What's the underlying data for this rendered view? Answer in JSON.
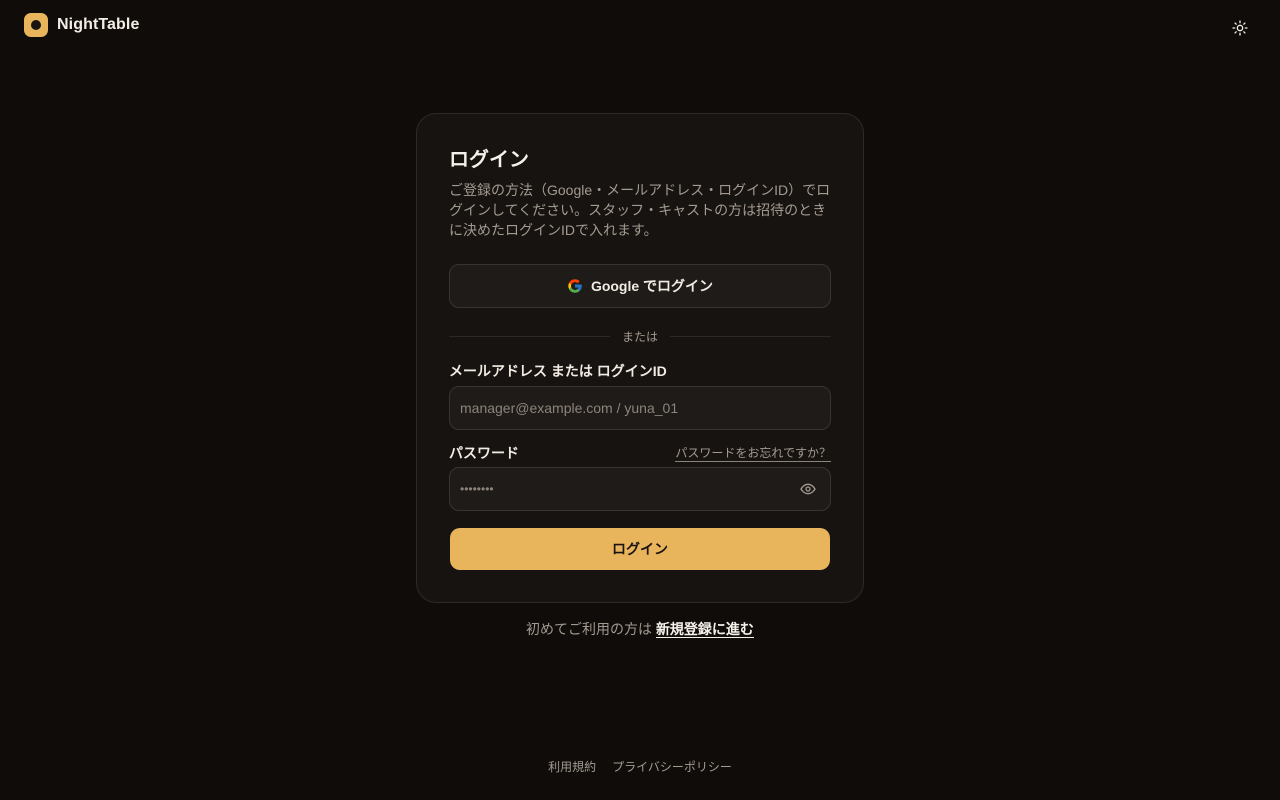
{
  "brand": {
    "name": "NightTable"
  },
  "header": {
    "theme_icon": "sun-icon"
  },
  "card": {
    "title": "ログイン",
    "description": "ご登録の方法（Google・メールアドレス・ログインID）でログインしてください。スタッフ・キャストの方は招待のときに決めたログインIDで入れます。",
    "google_button": {
      "label": "Google でログイン",
      "icon": "google-icon"
    },
    "divider_text": "または",
    "email": {
      "label": "メールアドレス または ログインID",
      "placeholder": "manager@example.com / yuna_01",
      "value": ""
    },
    "password": {
      "label": "パスワード",
      "forgot_link": "パスワードをお忘れですか？",
      "masked_value": "••••••••",
      "toggle_icon": "eye-icon"
    },
    "login_button": {
      "label": "ログイン"
    }
  },
  "signup": {
    "prompt": "初めてご利用の方は",
    "link": "新規登録に進む"
  },
  "footer": {
    "terms": "利用規約",
    "privacy": "プライバシーポリシー"
  },
  "colors": {
    "background": "#0f0c0a",
    "card": "#171310",
    "accent": "#e8b45c"
  }
}
